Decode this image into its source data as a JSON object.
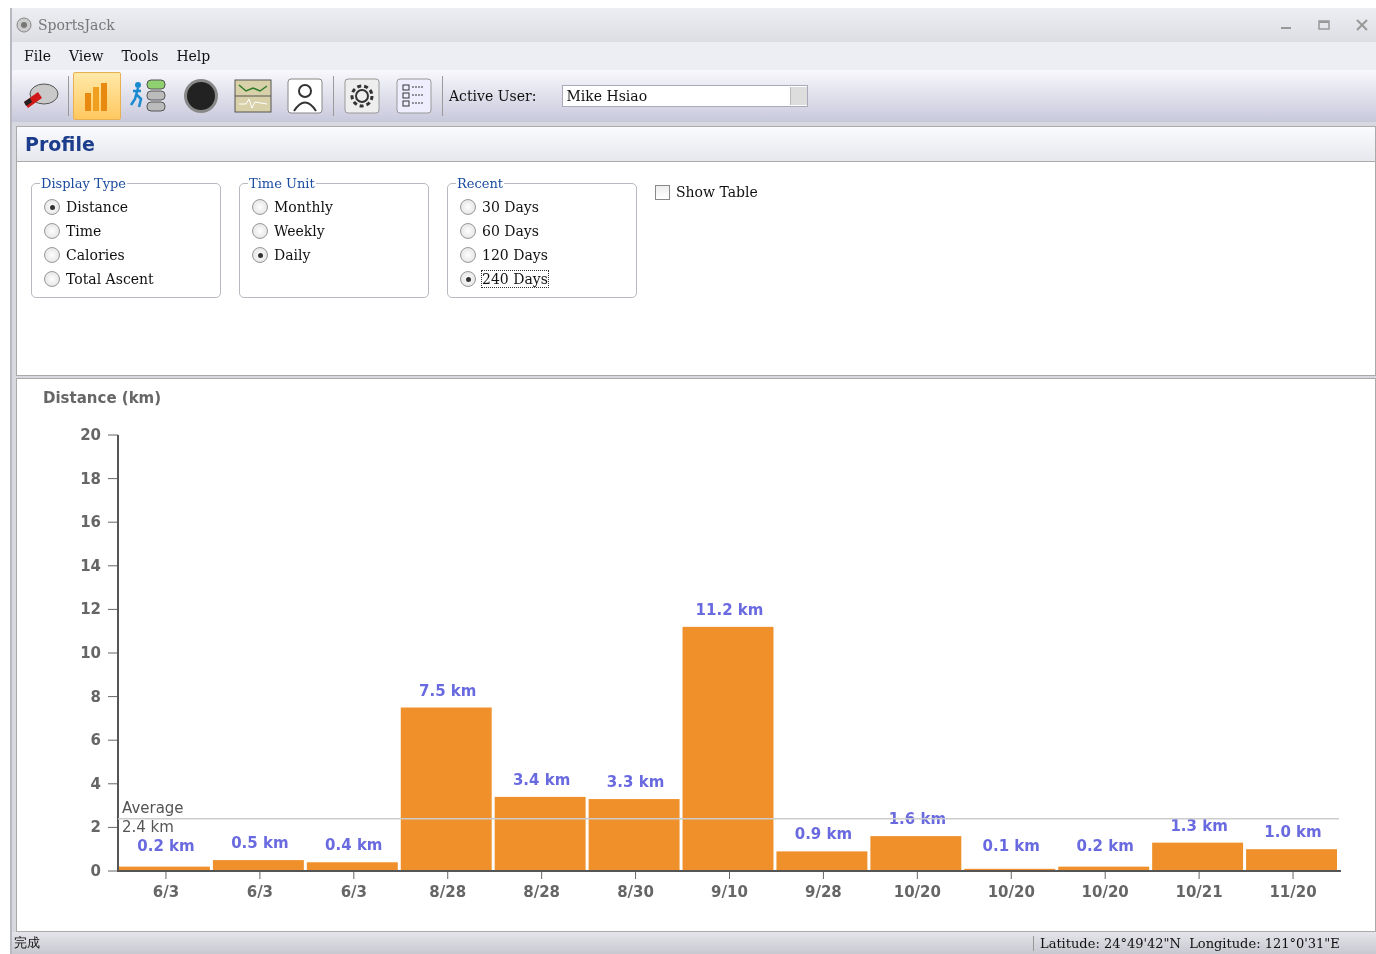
{
  "window": {
    "title": "SportsJack"
  },
  "menu": [
    "File",
    "View",
    "Tools",
    "Help"
  ],
  "toolbar": [
    {
      "selected": false
    },
    {
      "selected": true
    },
    {
      "selected": false
    },
    {
      "selected": false
    },
    {
      "selected": false
    },
    {
      "selected": false
    },
    {
      "selected": false
    },
    {
      "selected": false
    }
  ],
  "active_user": {
    "label": "Active User:",
    "value": "Mike Hsiao"
  },
  "section_title": "Profile",
  "groups": [
    {
      "title": "Display Type",
      "options": [
        {
          "label": "Distance",
          "selected": true,
          "focused": false
        },
        {
          "label": "Time",
          "selected": false,
          "focused": false
        },
        {
          "label": "Calories",
          "selected": false,
          "focused": false
        },
        {
          "label": "Total Ascent",
          "selected": false,
          "focused": false
        }
      ]
    },
    {
      "title": "Time Unit",
      "options": [
        {
          "label": "Monthly",
          "selected": false,
          "focused": false
        },
        {
          "label": "Weekly",
          "selected": false,
          "focused": false
        },
        {
          "label": "Daily",
          "selected": true,
          "focused": false
        }
      ]
    },
    {
      "title": "Recent",
      "options": [
        {
          "label": "30 Days",
          "selected": false,
          "focused": false
        },
        {
          "label": "60 Days",
          "selected": false,
          "focused": false
        },
        {
          "label": "120 Days",
          "selected": false,
          "focused": false
        },
        {
          "label": "240 Days",
          "selected": true,
          "focused": true
        }
      ]
    }
  ],
  "show_table": {
    "label": "Show Table",
    "checked": false
  },
  "chart_data": {
    "type": "bar",
    "ylabel": "Distance (km)",
    "categories": [
      "6/3",
      "6/3",
      "6/3",
      "8/28",
      "8/28",
      "8/30",
      "9/10",
      "9/28",
      "10/20",
      "10/20",
      "10/20",
      "10/21",
      "11/20"
    ],
    "values": [
      0.2,
      0.5,
      0.4,
      7.5,
      3.4,
      3.3,
      11.2,
      0.9,
      1.6,
      0.1,
      0.2,
      1.3,
      1.0
    ],
    "value_labels": [
      "0.2 km",
      "0.5 km",
      "0.4 km",
      "7.5 km",
      "3.4 km",
      "3.3 km",
      "11.2 km",
      "0.9 km",
      "1.6 km",
      "0.1 km",
      "0.2 km",
      "1.3 km",
      "1.0 km"
    ],
    "ylim": [
      0,
      20
    ],
    "yticks": [
      0,
      2,
      4,
      6,
      8,
      10,
      12,
      14,
      16,
      18,
      20
    ],
    "ref_lines": [
      {
        "axis": "y",
        "value": 2.4,
        "label": "Average 2.4 km"
      }
    ]
  },
  "status_bar": {
    "left": "完成",
    "right": "Latitude: 24°49'42\"N  Longitude: 121°0'31\"E"
  }
}
